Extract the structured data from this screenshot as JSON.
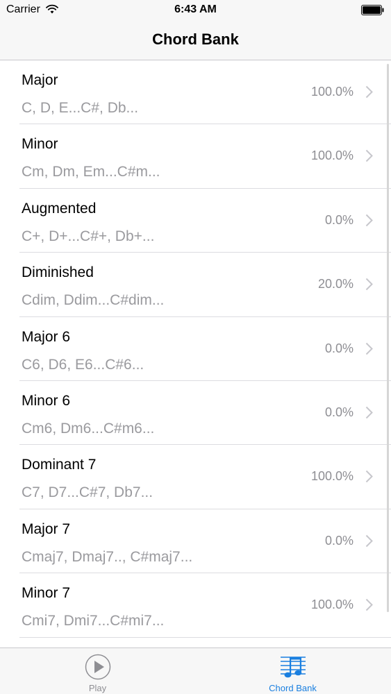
{
  "status_bar": {
    "carrier": "Carrier",
    "time": "6:43 AM",
    "icons": [
      "wifi-icon",
      "battery-icon"
    ]
  },
  "nav": {
    "title": "Chord Bank"
  },
  "chords": [
    {
      "title": "Major",
      "subtitle": "C, D, E...C#, Db...",
      "value": "100.0%"
    },
    {
      "title": "Minor",
      "subtitle": "Cm, Dm, Em...C#m...",
      "value": "100.0%"
    },
    {
      "title": "Augmented",
      "subtitle": "C+, D+...C#+, Db+...",
      "value": "0.0%"
    },
    {
      "title": "Diminished",
      "subtitle": "Cdim, Ddim...C#dim...",
      "value": "20.0%"
    },
    {
      "title": "Major 6",
      "subtitle": "C6, D6, E6...C#6...",
      "value": "0.0%"
    },
    {
      "title": "Minor 6",
      "subtitle": "Cm6, Dm6...C#m6...",
      "value": "0.0%"
    },
    {
      "title": "Dominant 7",
      "subtitle": "C7, D7...C#7, Db7...",
      "value": "100.0%"
    },
    {
      "title": "Major 7",
      "subtitle": "Cmaj7, Dmaj7.., C#maj7...",
      "value": "0.0%"
    },
    {
      "title": "Minor 7",
      "subtitle": "Cmi7, Dmi7...C#mi7...",
      "value": "100.0%"
    }
  ],
  "tab_bar": {
    "tabs": [
      {
        "label": "Play",
        "icon": "play-icon",
        "active": false
      },
      {
        "label": "Chord Bank",
        "icon": "sheet-music-icon",
        "active": true
      }
    ],
    "active_color": "#1a7fe0",
    "inactive_color": "#8e8e93"
  }
}
